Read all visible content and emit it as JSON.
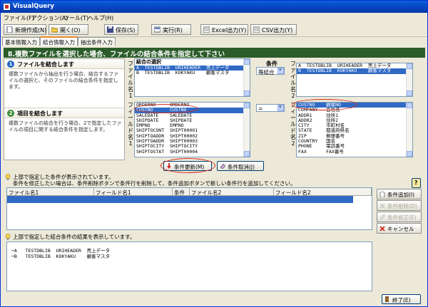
{
  "window": {
    "title": "VisualQuery"
  },
  "menu": [
    {
      "label": "ファイル(F)"
    },
    {
      "label": "アクション(A)"
    },
    {
      "label": "ツール(T)"
    },
    {
      "label": "ヘルプ(H)"
    }
  ],
  "toolbar": {
    "new_label": "新規作成(N)",
    "open_label": "開く(O)",
    "save_label": "保存(S)",
    "run_label": "実行(R)",
    "excel_label": "Excel出力(Y)",
    "csv_label": "CSV出力(Y)"
  },
  "tabs": [
    {
      "label": "基本情報入力"
    },
    {
      "label": "結合情報入力"
    },
    {
      "label": "抽出条件入力"
    }
  ],
  "banner": "Ⅱ.複数ファイルを選択した場合、ファイルの結合条件を指定して下さい",
  "left_panel": {
    "section1": {
      "num": "1",
      "title": "ファイルを結合します",
      "desc": "複数ファイルから抽出を行う場合、結合するファイルの選択と、そのファイルの結合条件を指定します。"
    },
    "section2": {
      "num": "2",
      "title": "項目を結合します",
      "desc": "複数ファイルの結合を行う場合、2で指定したファイルの項目に関する結合条件を指定します。"
    }
  },
  "file1": {
    "vlabel": "ファイル名1",
    "header": "結合の選択",
    "rows": [
      {
        "text": "A  TESTDBLIB  URIHEADER  売上データ",
        "selected": true
      },
      {
        "text": "B  TESTDBLIB  KOKYAKU    顧客マスタ",
        "selected": false
      }
    ]
  },
  "condition": {
    "header": "条件",
    "join_value": "等結合",
    "field_op": "="
  },
  "file2": {
    "vlabel": "ファイル名2",
    "rows": [
      {
        "text": "A  TESTDBLIB  URIHEADER  売上データ",
        "selected": false
      },
      {
        "text": "B  TESTDBLIB  KOKYAKU    顧客マスタ",
        "selected": true
      }
    ]
  },
  "field1": {
    "vlabel": "フィールド名1",
    "rows": [
      {
        "text": "ORDERNO     ORDERNO",
        "selected": false
      },
      {
        "text": "CUSTNO      CUSTNO",
        "selected": true
      },
      {
        "text": "SALEDATE    SALEDATE",
        "selected": false
      },
      {
        "text": "SHIPDATE    SHIPDATE",
        "selected": false
      },
      {
        "text": "EMPNO       EMPNO",
        "selected": false
      },
      {
        "text": "SHIPTOCONT  SHIPT00001",
        "selected": false
      },
      {
        "text": "SHIPTOADDR  SHIPT00002",
        "selected": false
      },
      {
        "text": "SHIPTOADDR  SHIPT00003",
        "selected": false
      },
      {
        "text": "SHIPTOCITY  SHIPTOCITY",
        "selected": false
      },
      {
        "text": "SHIPTOSTAT  SHIPT00004",
        "selected": false
      }
    ]
  },
  "field2": {
    "vlabel": "フィールド名2",
    "rows": [
      {
        "text": "CUSTNO    顧客NO",
        "selected": true
      },
      {
        "text": "COMPANY   会社名",
        "selected": false
      },
      {
        "text": "ADDR1     住所1",
        "selected": false
      },
      {
        "text": "ADDR2     住所2",
        "selected": false
      },
      {
        "text": "CITY      市町村名",
        "selected": false
      },
      {
        "text": "STATE     都道府県名",
        "selected": false
      },
      {
        "text": "ZIP       郵便番号",
        "selected": false
      },
      {
        "text": "COUNTRY   国名",
        "selected": false
      },
      {
        "text": "PHONE     電話番号",
        "selected": false
      },
      {
        "text": "FAX       FAX番号",
        "selected": false
      }
    ]
  },
  "buttons": {
    "update": "条件更新(M)",
    "cancel_cond": "条件取消(J)"
  },
  "info1": {
    "line1": "上部で指定した条件が表示されています。",
    "line2": "条件を修正したい場合は、条件削除ボタンで条件行を削除して、条件追加ボタンで新しい条件行を追加してください。"
  },
  "grid": {
    "columns": [
      "ファイル名1",
      "フィールド名1",
      "条件",
      "ファイル名2",
      "フィールド名2"
    ]
  },
  "side_buttons": {
    "add": "条件追加(I)",
    "delete": "条件削除(D)",
    "modify": "条件修正(E)",
    "cancel": "キャンセル"
  },
  "info2": {
    "line1": "上部で指定した結合条件の結果を表示しています。"
  },
  "tree": [
    {
      "text": "─A   TESTDBLIB  URIHEADER  売上データ"
    },
    {
      "text": "─B   TESTDBLIB  KOKYAKU    顧客マスタ"
    }
  ],
  "exit_label": "終了(E)",
  "help_label": "?"
}
